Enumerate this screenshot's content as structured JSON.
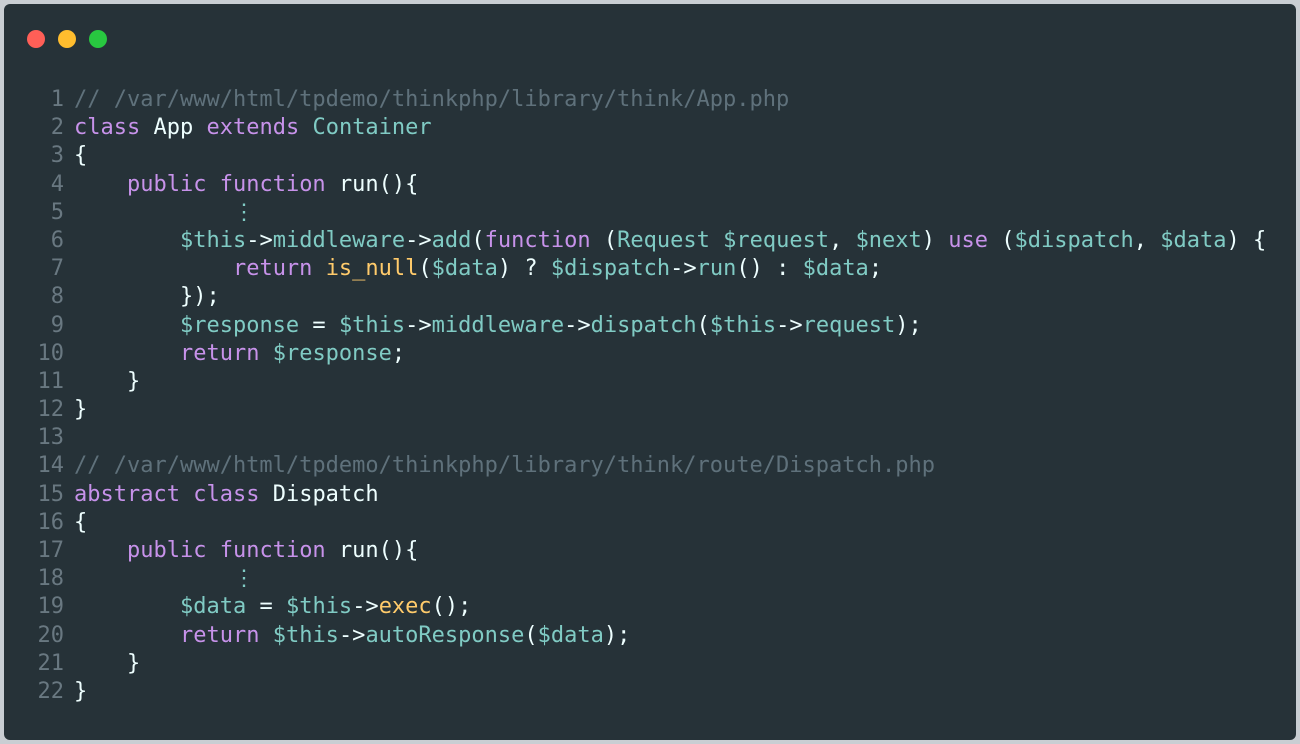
{
  "window": {
    "controls": [
      "close",
      "minimize",
      "maximize"
    ],
    "colors": {
      "background": "#263238",
      "close": "#ff5f57",
      "minimize": "#ffbd2e",
      "maximize": "#28c840"
    }
  },
  "code": {
    "lines": [
      {
        "n": "1",
        "tokens": [
          [
            "comment",
            "// /var/www/html/tpdemo/thinkphp/library/think/App.php"
          ]
        ]
      },
      {
        "n": "2",
        "tokens": [
          [
            "keyword",
            "class"
          ],
          [
            "punct",
            " "
          ],
          [
            "ident",
            "App"
          ],
          [
            "punct",
            " "
          ],
          [
            "keyword",
            "extends"
          ],
          [
            "punct",
            " "
          ],
          [
            "type",
            "Container"
          ]
        ]
      },
      {
        "n": "3",
        "tokens": [
          [
            "punct",
            "{"
          ]
        ]
      },
      {
        "n": "4",
        "tokens": [
          [
            "punct",
            "    "
          ],
          [
            "keyword",
            "public"
          ],
          [
            "punct",
            " "
          ],
          [
            "keyword",
            "function"
          ],
          [
            "punct",
            " "
          ],
          [
            "ident",
            "run(){"
          ]
        ]
      },
      {
        "n": "5",
        "tokens": [
          [
            "punct",
            "            "
          ],
          [
            "dots",
            "⋮"
          ]
        ]
      },
      {
        "n": "6",
        "tokens": [
          [
            "punct",
            "        "
          ],
          [
            "var",
            "$this"
          ],
          [
            "op",
            "->"
          ],
          [
            "func",
            "middleware"
          ],
          [
            "op",
            "->"
          ],
          [
            "func",
            "add"
          ],
          [
            "punct",
            "("
          ],
          [
            "keyword",
            "function"
          ],
          [
            "punct",
            " ("
          ],
          [
            "type",
            "Request"
          ],
          [
            "punct",
            " "
          ],
          [
            "var",
            "$request"
          ],
          [
            "punct",
            ", "
          ],
          [
            "var",
            "$next"
          ],
          [
            "punct",
            ") "
          ],
          [
            "keyword",
            "use"
          ],
          [
            "punct",
            " ("
          ],
          [
            "var",
            "$dispatch"
          ],
          [
            "punct",
            ", "
          ],
          [
            "var",
            "$data"
          ],
          [
            "punct",
            ") {"
          ]
        ]
      },
      {
        "n": "7",
        "tokens": [
          [
            "punct",
            "            "
          ],
          [
            "keyword",
            "return"
          ],
          [
            "punct",
            " "
          ],
          [
            "call",
            "is_null"
          ],
          [
            "punct",
            "("
          ],
          [
            "var",
            "$data"
          ],
          [
            "punct",
            ") ? "
          ],
          [
            "var",
            "$dispatch"
          ],
          [
            "op",
            "->"
          ],
          [
            "func",
            "run"
          ],
          [
            "punct",
            "() : "
          ],
          [
            "var",
            "$data"
          ],
          [
            "punct",
            ";"
          ]
        ]
      },
      {
        "n": "8",
        "tokens": [
          [
            "punct",
            "        });"
          ]
        ]
      },
      {
        "n": "9",
        "tokens": [
          [
            "punct",
            "        "
          ],
          [
            "var",
            "$response"
          ],
          [
            "punct",
            " = "
          ],
          [
            "var",
            "$this"
          ],
          [
            "op",
            "->"
          ],
          [
            "func",
            "middleware"
          ],
          [
            "op",
            "->"
          ],
          [
            "func",
            "dispatch"
          ],
          [
            "punct",
            "("
          ],
          [
            "var",
            "$this"
          ],
          [
            "op",
            "->"
          ],
          [
            "func",
            "request"
          ],
          [
            "punct",
            ");"
          ]
        ]
      },
      {
        "n": "10",
        "tokens": [
          [
            "punct",
            "        "
          ],
          [
            "keyword",
            "return"
          ],
          [
            "punct",
            " "
          ],
          [
            "var",
            "$response"
          ],
          [
            "punct",
            ";"
          ]
        ]
      },
      {
        "n": "11",
        "tokens": [
          [
            "punct",
            "    }"
          ]
        ]
      },
      {
        "n": "12",
        "tokens": [
          [
            "punct",
            "}"
          ]
        ]
      },
      {
        "n": "13",
        "tokens": [
          [
            "punct",
            ""
          ]
        ]
      },
      {
        "n": "14",
        "tokens": [
          [
            "comment",
            "// /var/www/html/tpdemo/thinkphp/library/think/route/Dispatch.php"
          ]
        ]
      },
      {
        "n": "15",
        "tokens": [
          [
            "keyword",
            "abstract"
          ],
          [
            "punct",
            " "
          ],
          [
            "keyword",
            "class"
          ],
          [
            "punct",
            " "
          ],
          [
            "ident",
            "Dispatch"
          ]
        ]
      },
      {
        "n": "16",
        "tokens": [
          [
            "punct",
            "{"
          ]
        ]
      },
      {
        "n": "17",
        "tokens": [
          [
            "punct",
            "    "
          ],
          [
            "keyword",
            "public"
          ],
          [
            "punct",
            " "
          ],
          [
            "keyword",
            "function"
          ],
          [
            "punct",
            " "
          ],
          [
            "ident",
            "run(){"
          ]
        ]
      },
      {
        "n": "18",
        "tokens": [
          [
            "punct",
            "            "
          ],
          [
            "dots",
            "⋮"
          ]
        ]
      },
      {
        "n": "19",
        "tokens": [
          [
            "punct",
            "        "
          ],
          [
            "var",
            "$data"
          ],
          [
            "punct",
            " = "
          ],
          [
            "var",
            "$this"
          ],
          [
            "op",
            "->"
          ],
          [
            "call",
            "exec"
          ],
          [
            "punct",
            "();"
          ]
        ]
      },
      {
        "n": "20",
        "tokens": [
          [
            "punct",
            "        "
          ],
          [
            "keyword",
            "return"
          ],
          [
            "punct",
            " "
          ],
          [
            "var",
            "$this"
          ],
          [
            "op",
            "->"
          ],
          [
            "func",
            "autoResponse"
          ],
          [
            "punct",
            "("
          ],
          [
            "var",
            "$data"
          ],
          [
            "punct",
            ");"
          ]
        ]
      },
      {
        "n": "21",
        "tokens": [
          [
            "punct",
            "    }"
          ]
        ]
      },
      {
        "n": "22",
        "tokens": [
          [
            "punct",
            "}"
          ]
        ]
      }
    ]
  }
}
